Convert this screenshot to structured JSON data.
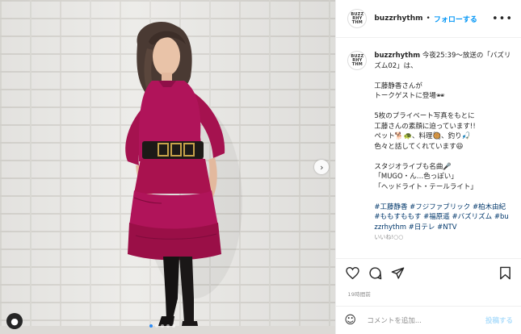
{
  "header": {
    "username": "buzzrhythm",
    "separator": "•",
    "follow_label": "フォローする",
    "more_label": "•••",
    "avatar_text": "BUZZ\nRHY\nTHM"
  },
  "caption": {
    "username": "buzzrhythm",
    "body": " 今夜25:39〜放送の「バズリズム02」は、\n\n工藤静香さんが\nトークゲストに登場🕶\n\n5枚のプライベート写真をもとに\n工藤さんの素顔に迫っています!!\nペット🐕🐢、料理🥘、釣り🎣\n色々と話してくれています😆\n\nスタジオライブも名曲🎤\n「MUGO・ん…色っぽい」\n「ヘッドライト・テールライト」\n\n",
    "hashtags": "#工藤静香 #フジファブリック #柏木由紀 #ももすももす #福原遥 #バズリズム #buzzrhythm #日テレ #NTV",
    "more_cut": "いいね!○○"
  },
  "actions": {
    "like_icon": "heart-icon",
    "comment_icon": "comment-icon",
    "share_icon": "share-icon",
    "save_icon": "bookmark-icon"
  },
  "timestamp": "19時間前",
  "comment": {
    "emoji_icon": "☺",
    "placeholder": "コメントを追加...",
    "post_label": "投稿する"
  },
  "photo": {
    "next_arrow": "›",
    "user_tag": "●",
    "carousel_count": 5,
    "carousel_active": 1
  },
  "colors": {
    "accent": "#0095f6",
    "dress": "#b0145a",
    "hashtag": "#00376b"
  }
}
